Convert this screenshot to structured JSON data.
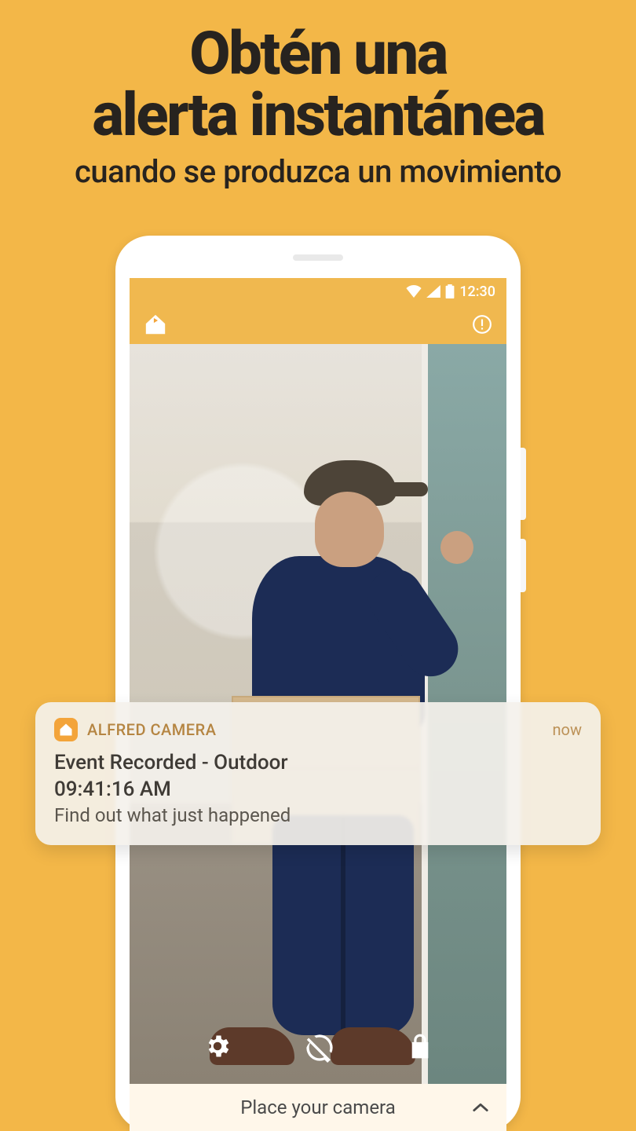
{
  "headline": {
    "line1": "Obtén una",
    "line2": "alerta instantánea",
    "sub": "cuando se produzca un movimiento"
  },
  "status_bar": {
    "time": "12:30"
  },
  "bottom_bar": {
    "label": "Place your camera"
  },
  "notification": {
    "app_name": "ALFRED CAMERA",
    "timestamp_label": "now",
    "title": "Event Recorded - Outdoor",
    "event_time": "09:41:16 AM",
    "body": "Find out what just happened"
  },
  "icons": {
    "app_logo": "alfred-home-icon",
    "header_alert": "alert-circle-icon",
    "settings": "gear-icon",
    "gps_off": "location-off-icon",
    "lock": "lock-icon",
    "chevron": "chevron-up-icon",
    "wifi": "wifi-icon",
    "signal": "signal-icon",
    "battery": "battery-icon"
  },
  "colors": {
    "background": "#f3b748",
    "accent": "#f3a43a",
    "text_dark": "#27231f"
  }
}
